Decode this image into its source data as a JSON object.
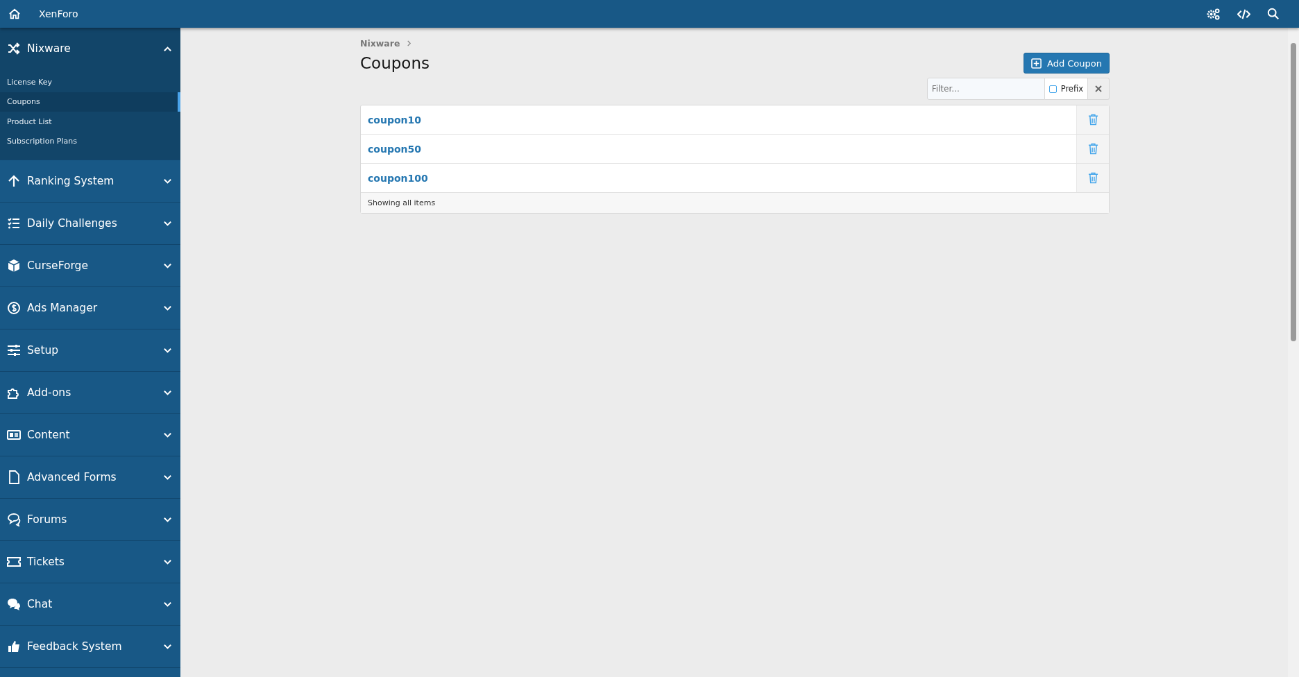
{
  "topbar": {
    "title": "XenForo"
  },
  "sidebar": {
    "sections": [
      {
        "label": "Nixware",
        "expanded": true,
        "children": [
          {
            "label": "License Key",
            "selected": false
          },
          {
            "label": "Coupons",
            "selected": true
          },
          {
            "label": "Product List",
            "selected": false
          },
          {
            "label": "Subscription Plans",
            "selected": false
          }
        ]
      },
      {
        "label": "Ranking System",
        "expanded": false
      },
      {
        "label": "Daily Challenges",
        "expanded": false
      },
      {
        "label": "CurseForge",
        "expanded": false
      },
      {
        "label": "Ads Manager",
        "expanded": false
      },
      {
        "label": "Setup",
        "expanded": false
      },
      {
        "label": "Add-ons",
        "expanded": false
      },
      {
        "label": "Content",
        "expanded": false
      },
      {
        "label": "Advanced Forms",
        "expanded": false
      },
      {
        "label": "Forums",
        "expanded": false
      },
      {
        "label": "Tickets",
        "expanded": false
      },
      {
        "label": "Chat",
        "expanded": false
      },
      {
        "label": "Feedback System",
        "expanded": false
      }
    ]
  },
  "breadcrumb": [
    "Nixware"
  ],
  "page_title": "Coupons",
  "add_button": "Add Coupon",
  "filter": {
    "placeholder": "Filter...",
    "prefix_label": "Prefix",
    "prefix_checked": false
  },
  "rows": [
    {
      "name": "coupon10"
    },
    {
      "name": "coupon50"
    },
    {
      "name": "coupon100"
    }
  ],
  "footer": "Showing all items"
}
